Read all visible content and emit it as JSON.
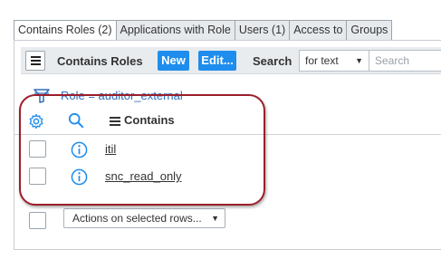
{
  "tabs": [
    {
      "label": "Contains Roles (2)",
      "active": true
    },
    {
      "label": "Applications with Role",
      "active": false
    },
    {
      "label": "Users (1)",
      "active": false
    },
    {
      "label": "Access to",
      "active": false
    },
    {
      "label": "Groups",
      "active": false
    }
  ],
  "toolbar": {
    "title": "Contains Roles",
    "new_label": "New",
    "edit_label": "Edit...",
    "search_label": "Search",
    "search_field_value": "for text",
    "search_placeholder": "Search"
  },
  "filter": {
    "text": "Role = auditor_external"
  },
  "list": {
    "column_header": "Contains",
    "rows": [
      {
        "role": "itil"
      },
      {
        "role": "snc_read_only"
      }
    ]
  },
  "actions": {
    "selected": "Actions on selected rows..."
  },
  "colors": {
    "accent": "#1f8ded",
    "link_blue": "#2f6ebb",
    "annotation": "#9b1f2a"
  }
}
